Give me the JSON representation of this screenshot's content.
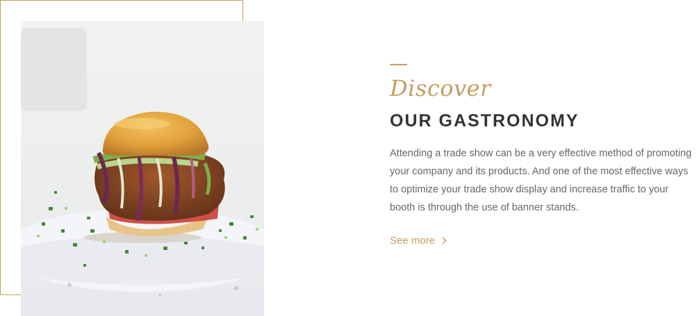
{
  "section": {
    "accent_color": "#c59d5f",
    "script_title": "Discover",
    "title": "OUR GASTRONOMY",
    "description": "Attending a trade show can be a very effective method of promoting your company and its products. And one of the most effective ways to optimize your trade show display and increase traffic to your booth is through the use of banner stands.",
    "link_label": "See more",
    "link_icon": "chevron-right-icon"
  }
}
